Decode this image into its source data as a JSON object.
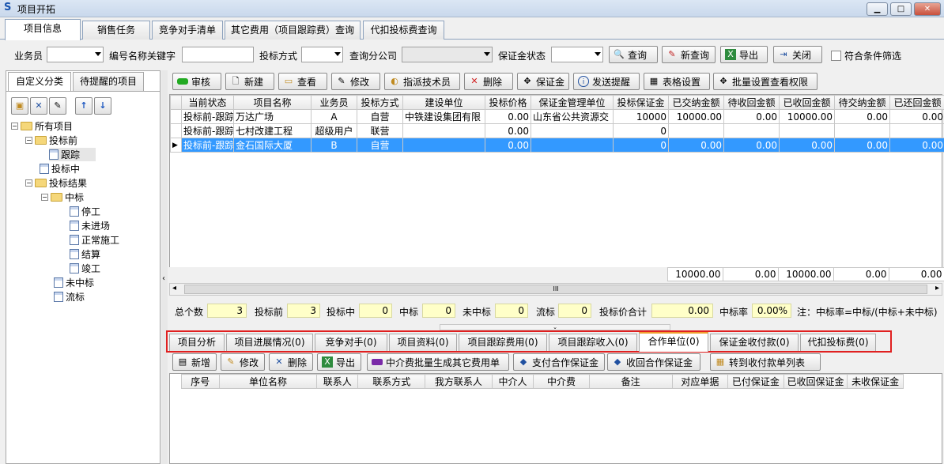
{
  "window": {
    "title": "项目开拓",
    "min": "▁",
    "max": "□",
    "close": "✕"
  },
  "top_tabs": [
    "项目信息",
    "销售任务",
    "竞争对手清单",
    "其它费用（项目跟踪费）查询",
    "代扣投标费查询"
  ],
  "filter": {
    "salesman_label": "业务员",
    "keyword_label": "编号名称关键字",
    "bid_method_label": "投标方式",
    "branch_label": "查询分公司",
    "deposit_status_label": "保证金状态",
    "query_btn": "查询",
    "new_query_btn": "新查询",
    "export_btn": "导出",
    "close_btn": "关闭",
    "match_filter_label": "符合条件筛选"
  },
  "left": {
    "tabs": [
      "自定义分类",
      "待提醒的项目"
    ],
    "tree": [
      {
        "label": "所有项目",
        "level": 0,
        "icon": "folder-icon",
        "pm": "−"
      },
      {
        "label": "投标前",
        "level": 1,
        "icon": "folder-icon",
        "pm": "−"
      },
      {
        "label": "跟踪",
        "level": 2,
        "icon": "doc-icon",
        "pm": ""
      },
      {
        "label": "投标中",
        "level": 1,
        "icon": "doc-icon",
        "pm": ""
      },
      {
        "label": "投标结果",
        "level": 1,
        "icon": "folder-icon",
        "pm": "−"
      },
      {
        "label": "中标",
        "level": 2,
        "icon": "folder-icon",
        "pm": "−"
      },
      {
        "label": "停工",
        "level": 3,
        "icon": "doc-icon",
        "pm": ""
      },
      {
        "label": "未进场",
        "level": 3,
        "icon": "doc-icon",
        "pm": ""
      },
      {
        "label": "正常施工",
        "level": 3,
        "icon": "doc-icon",
        "pm": ""
      },
      {
        "label": "结算",
        "level": 3,
        "icon": "doc-icon",
        "pm": ""
      },
      {
        "label": "竣工",
        "level": 3,
        "icon": "doc-icon",
        "pm": ""
      },
      {
        "label": "未中标",
        "level": 2,
        "icon": "doc-icon",
        "pm": ""
      },
      {
        "label": "流标",
        "level": 2,
        "icon": "doc-icon",
        "pm": ""
      }
    ]
  },
  "toolbar": {
    "audit": "审核",
    "new": "新建",
    "view": "查看",
    "edit": "修改",
    "assign": "指派技术员",
    "delete": "删除",
    "deposit": "保证金",
    "remind": "发送提醒",
    "table_settings": "表格设置",
    "batch_perm": "批量设置查看权限"
  },
  "grid": {
    "headers": [
      "当前状态",
      "项目名称",
      "业务员",
      "投标方式",
      "建设单位",
      "投标价格",
      "保证金管理单位",
      "投标保证金",
      "已交纳金额",
      "待收回金额",
      "已收回金额",
      "待交纳金额",
      "已还回金额"
    ],
    "rows": [
      [
        "投标前-跟踪",
        "万达广场",
        "A",
        "自营",
        "中铁建设集团有限",
        "0.00",
        "山东省公共资源交",
        "10000",
        "10000.00",
        "0.00",
        "10000.00",
        "0.00",
        "0.00"
      ],
      [
        "投标前-跟踪",
        "七村改建工程",
        "超级用户",
        "联营",
        "",
        "0.00",
        "",
        "0",
        "",
        "",
        "",
        "",
        ""
      ],
      [
        "投标前-跟踪",
        "金石国际大厦",
        "B",
        "自营",
        "",
        "0.00",
        "",
        "0",
        "0.00",
        "0.00",
        "0.00",
        "0.00",
        "0.00"
      ]
    ],
    "footer": [
      "",
      "",
      "",
      "",
      "",
      "",
      "",
      "",
      "10000.00",
      "0.00",
      "10000.00",
      "0.00",
      "0.00"
    ],
    "scroll_grip": "III"
  },
  "summary": {
    "total_label": "总个数",
    "total": "3",
    "pre_label": "投标前",
    "pre": "3",
    "mid_label": "投标中",
    "mid": "0",
    "win_label": "中标",
    "win": "0",
    "lose_label": "未中标",
    "lose": "0",
    "fail_label": "流标",
    "fail": "0",
    "price_label": "投标价合计",
    "price": "0.00",
    "rate_label": "中标率",
    "rate": "0.00%",
    "note": "注：中标率=中标/(中标+未中标)"
  },
  "bottom_tabs": [
    "项目分析",
    "项目进展情况(0)",
    "竞争对手(0)",
    "项目资料(0)",
    "项目跟踪费用(0)",
    "项目跟踪收入(0)",
    "合作单位(0)",
    "保证金收付款(0)",
    "代扣投标费(0)"
  ],
  "bottom_toolbar": {
    "add": "新增",
    "edit": "修改",
    "delete": "删除",
    "export": "导出",
    "batch_fee": "中介费批量生成其它费用单",
    "pay_deposit": "支付合作保证金",
    "recv_deposit": "收回合作保证金",
    "to_list": "转到收付款单列表"
  },
  "bottom_grid": {
    "headers": [
      "序号",
      "单位名称",
      "联系人",
      "联系方式",
      "我方联系人",
      "中介人",
      "中介费",
      "备注",
      "对应单据",
      "已付保证金",
      "已收回保证金",
      "未收保证金"
    ]
  },
  "colors": {
    "selected_row": "#3399ff",
    "highlight_border": "#e02020",
    "summary_fill": "#ffffc8"
  }
}
